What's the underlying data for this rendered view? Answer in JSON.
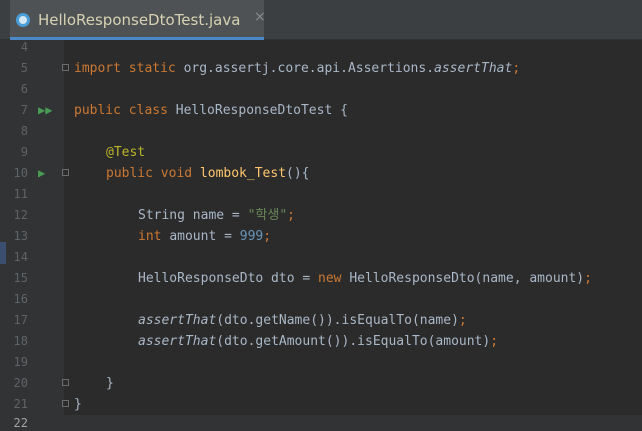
{
  "tab": {
    "title": "HelloResponseDtoTest.java",
    "close": "×",
    "icon": "java-class-icon"
  },
  "colors": {
    "background": "#2b2b2b",
    "keyword": "#cc7832",
    "annotation": "#bbb529",
    "method": "#ffc66d",
    "string": "#6a8759",
    "number": "#6897bb",
    "text": "#a9b7c6"
  },
  "lines": {
    "l4": {
      "num": "4"
    },
    "l5": {
      "num": "5",
      "t1": "import static ",
      "t2": "org.assertj.core.api.Assertions.",
      "t3": "assertThat",
      "t4": ";"
    },
    "l6": {
      "num": "6"
    },
    "l7": {
      "num": "7",
      "t1": "public class ",
      "t2": "HelloResponseDtoTest {"
    },
    "l8": {
      "num": "8"
    },
    "l9": {
      "num": "9",
      "t1": "@Test"
    },
    "l10": {
      "num": "10",
      "t1": "public void ",
      "t2": "lombok_Test",
      "t3": "(){"
    },
    "l11": {
      "num": "11"
    },
    "l12": {
      "num": "12",
      "t1": "String name = ",
      "t2": "\"학생\"",
      "t3": ";"
    },
    "l13": {
      "num": "13",
      "t1": "int ",
      "t2": "amount = ",
      "t3": "999",
      "t4": ";"
    },
    "l14": {
      "num": "14"
    },
    "l15": {
      "num": "15",
      "t1": "HelloResponseDto dto = ",
      "t2": "new ",
      "t3": "HelloResponseDto(name, amount)",
      "t4": ";"
    },
    "l16": {
      "num": "16"
    },
    "l17": {
      "num": "17",
      "t1": "assertThat",
      "t2": "(dto.getName()).isEqualTo(name)",
      "t3": ";"
    },
    "l18": {
      "num": "18",
      "t1": "assertThat",
      "t2": "(dto.getAmount()).isEqualTo(amount)",
      "t3": ";"
    },
    "l19": {
      "num": "19"
    },
    "l20": {
      "num": "20",
      "t1": "}"
    },
    "l21": {
      "num": "21",
      "t1": "}"
    },
    "l22": {
      "num": "22"
    }
  }
}
